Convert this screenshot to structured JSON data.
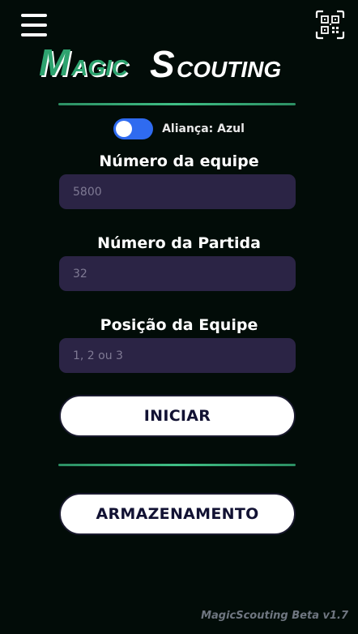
{
  "header": {
    "menu_icon": "hamburger-menu-icon",
    "qr_icon": "qr-code-icon",
    "logo": {
      "part1": "Magic",
      "part2": "Scouting",
      "color": "#2ea36f"
    }
  },
  "alliance": {
    "label": "Aliança: Azul",
    "toggle_color": "#2f6bf0",
    "on": true
  },
  "fields": {
    "team": {
      "label": "Número da equipe",
      "placeholder": "5800"
    },
    "match": {
      "label": "Número da Partida",
      "placeholder": "32"
    },
    "position": {
      "label": "Posição da Equipe",
      "placeholder": "1, 2 ou 3"
    }
  },
  "buttons": {
    "start": "INICIAR",
    "storage": "ARMAZENAMENTO"
  },
  "footer": {
    "version": "MagicScouting Beta v1.7"
  },
  "colors": {
    "background": "#020c08",
    "input_bg": "#2b2445",
    "divider": "#3fbf85"
  }
}
